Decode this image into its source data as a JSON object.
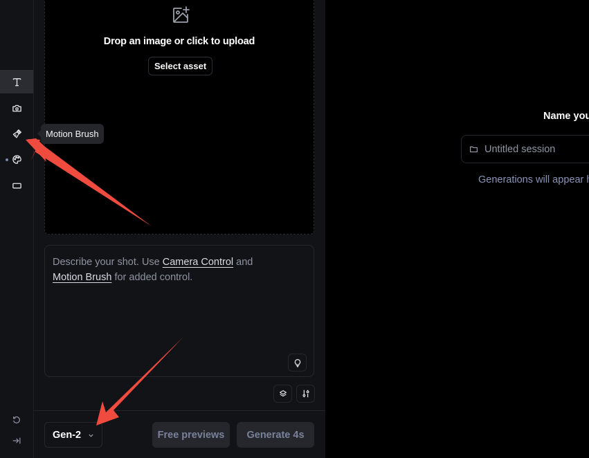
{
  "sidebar": {
    "items": [
      {
        "name": "text-mode",
        "icon": "text-icon",
        "active": true
      },
      {
        "name": "camera-control",
        "icon": "camera-icon",
        "active": false
      },
      {
        "name": "motion-brush",
        "icon": "brush-icon",
        "active": false
      },
      {
        "name": "style",
        "icon": "palette-icon",
        "active": false,
        "indicator": true
      },
      {
        "name": "aspect-ratio",
        "icon": "rectangle-icon",
        "active": false
      }
    ],
    "bottom": [
      {
        "name": "reset",
        "icon": "reset-icon"
      },
      {
        "name": "collapse",
        "icon": "collapse-right-icon"
      }
    ]
  },
  "tooltip": {
    "text": "Motion Brush"
  },
  "upload": {
    "icon": "image-add-icon",
    "text": "Drop an image or click to upload",
    "button_label": "Select asset"
  },
  "prompt": {
    "placeholder_before": "Describe your shot. Use ",
    "link1": "Camera Control",
    "between": " and ",
    "link2": "Motion Brush",
    "after": " for added control.",
    "idea_icon": "lightbulb-icon"
  },
  "tools": {
    "presets_icon": "layers-icon",
    "settings_icon": "sliders-icon"
  },
  "footer": {
    "model": "Gen-2",
    "free_previews": "Free previews",
    "generate": "Generate 4s"
  },
  "session": {
    "title": "Name you",
    "placeholder": "Untitled session",
    "hint": "Generations will appear h"
  },
  "colors": {
    "panel_bg": "#121317",
    "canvas_bg": "#000000",
    "annotation_arrow": "#ef4b3f",
    "disabled_text": "#79829a"
  }
}
